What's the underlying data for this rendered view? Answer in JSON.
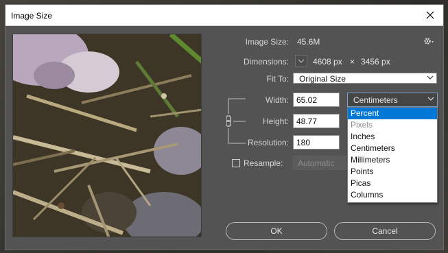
{
  "dialog": {
    "title": "Image Size"
  },
  "info": {
    "image_size_label": "Image Size:",
    "image_size_value": "45.6M",
    "dimensions_label": "Dimensions:",
    "dim_width": "4608 px",
    "dim_times": "×",
    "dim_height": "3456 px",
    "fit_to_label": "Fit To:",
    "fit_to_value": "Original Size"
  },
  "fields": {
    "width_label": "Width:",
    "width_value": "65.02",
    "height_label": "Height:",
    "height_value": "48.77",
    "resolution_label": "Resolution:",
    "resolution_value": "180",
    "unit_value": "Centimeters"
  },
  "unit_options": [
    {
      "label": "Percent",
      "state": "selected"
    },
    {
      "label": "Pixels",
      "state": "disabled"
    },
    {
      "label": "Inches",
      "state": "normal"
    },
    {
      "label": "Centimeters",
      "state": "normal"
    },
    {
      "label": "Millimeters",
      "state": "normal"
    },
    {
      "label": "Points",
      "state": "normal"
    },
    {
      "label": "Picas",
      "state": "normal"
    },
    {
      "label": "Columns",
      "state": "normal"
    }
  ],
  "resample": {
    "label": "Resample:",
    "checked": false,
    "method": "Automatic"
  },
  "buttons": {
    "ok": "OK",
    "cancel": "Cancel"
  },
  "colors": {
    "dialog_bg": "#535353",
    "selection": "#0078d7",
    "focus_border": "#7b9fd1"
  }
}
